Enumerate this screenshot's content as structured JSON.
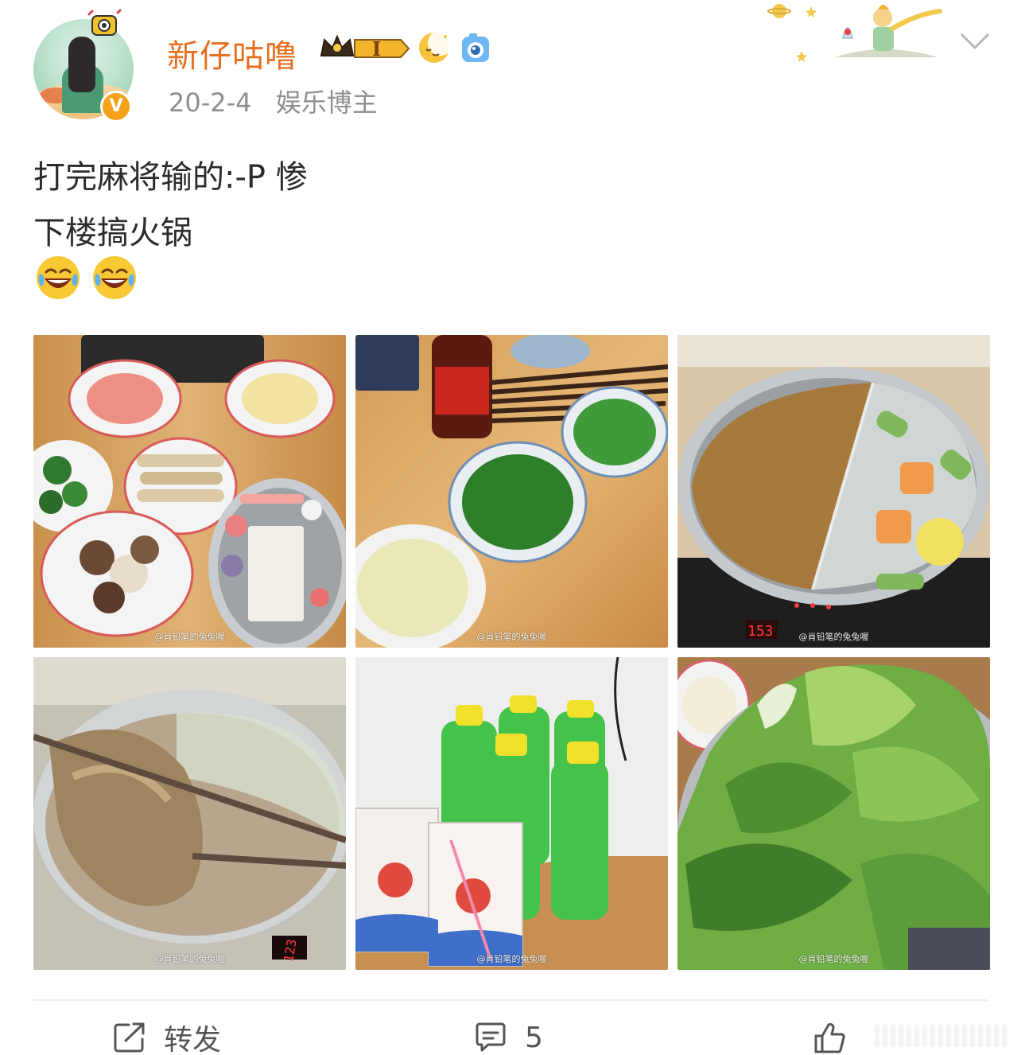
{
  "post": {
    "author": {
      "name": "新仔咕噜",
      "badge_level": "I",
      "verified_mark": "V"
    },
    "meta": {
      "date": "20-2-4",
      "role": "娱乐博主"
    },
    "content": {
      "lines": [
        "打完麻将输的:-P 惨",
        "下楼搞火锅"
      ],
      "emojis": [
        "laugh-cry-emoji",
        "laugh-cry-emoji"
      ]
    },
    "photos": [
      {
        "subject": "sliced-sausage-potato-broccoli-mushroom-meatballs",
        "watermark": "@肖铅笔的兔兔喔"
      },
      {
        "subject": "coriander-scallion-garlic-soy-sauce-chopsticks",
        "watermark": "@肖铅笔的兔兔喔"
      },
      {
        "subject": "yuanyang-hotpot-on-induction-cooker",
        "watermark": "@肖铅笔的兔兔喔"
      },
      {
        "subject": "cooked-tripe-with-chopsticks",
        "watermark": "@肖铅笔的兔兔喔"
      },
      {
        "subject": "green-soda-bottles-and-yogurt-boxes",
        "watermark": "@肖铅笔的兔兔喔"
      },
      {
        "subject": "leafy-greens-platter",
        "watermark": "@肖铅笔的兔兔喔"
      }
    ],
    "cooker_displays": [
      "153",
      "123"
    ],
    "actions": {
      "repost_label": "转发",
      "comment_count": "5"
    }
  },
  "colors": {
    "username": "#e86e1e",
    "meta": "#8e8e8e",
    "verified": "#f7a21b",
    "text": "#2b2b2b"
  },
  "icons": [
    "chevron-down-icon",
    "share-icon",
    "comment-icon",
    "like-icon",
    "vip-crown-icon",
    "moon-emoji-icon",
    "camera-emoji-icon"
  ]
}
